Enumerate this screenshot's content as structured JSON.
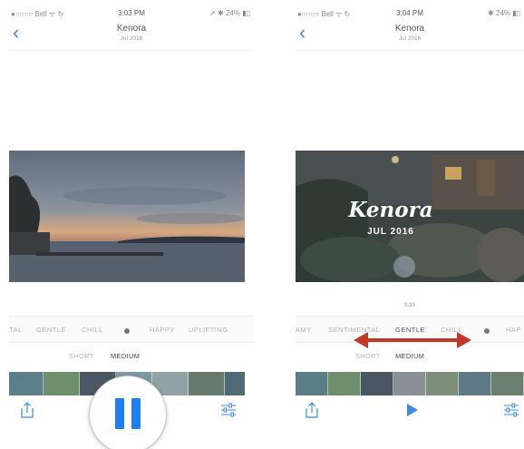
{
  "left": {
    "status": {
      "carrier": "●○○○○ Bell ᯤ ↻",
      "time": "3:03 PM",
      "right": "➚ ✱ 24% ▮▯"
    },
    "nav": {
      "back": "‹",
      "title": "Kenora",
      "subtitle": "Jul 2016"
    },
    "moods": [
      "TAL",
      "GENTLE",
      "CHILL",
      "HAPPY",
      "UPLIFTING"
    ],
    "lengths": [
      "SHORT",
      "MEDIUM"
    ],
    "active_length": "MEDIUM",
    "icons": {
      "share": "share-icon",
      "pause": "pause-icon",
      "settings": "sliders-icon"
    }
  },
  "right": {
    "status": {
      "carrier": "●○○○○ Bell ᯤ ↻",
      "time": "3:04 PM",
      "right": "✱ 24% ▮▯"
    },
    "nav": {
      "back": "‹",
      "title": "Kenora",
      "subtitle": "Jul 2016"
    },
    "overlay": {
      "title": "Kenora",
      "date": "JUL 2016"
    },
    "duration": "0:33",
    "moods": [
      "AMY",
      "SENTIMENTAL",
      "GENTLE",
      "CHILL",
      "HAP"
    ],
    "active_mood": "GENTLE",
    "lengths": [
      "SHORT",
      "MEDIUM"
    ],
    "active_length": "MEDIUM",
    "icons": {
      "share": "share-icon",
      "play": "play-icon",
      "settings": "sliders-icon",
      "swipe": "swipe-arrow-icon"
    }
  },
  "colors": {
    "accent": "#1f7ff0",
    "arrow": "#c0392b",
    "back": "#3b8be0"
  }
}
